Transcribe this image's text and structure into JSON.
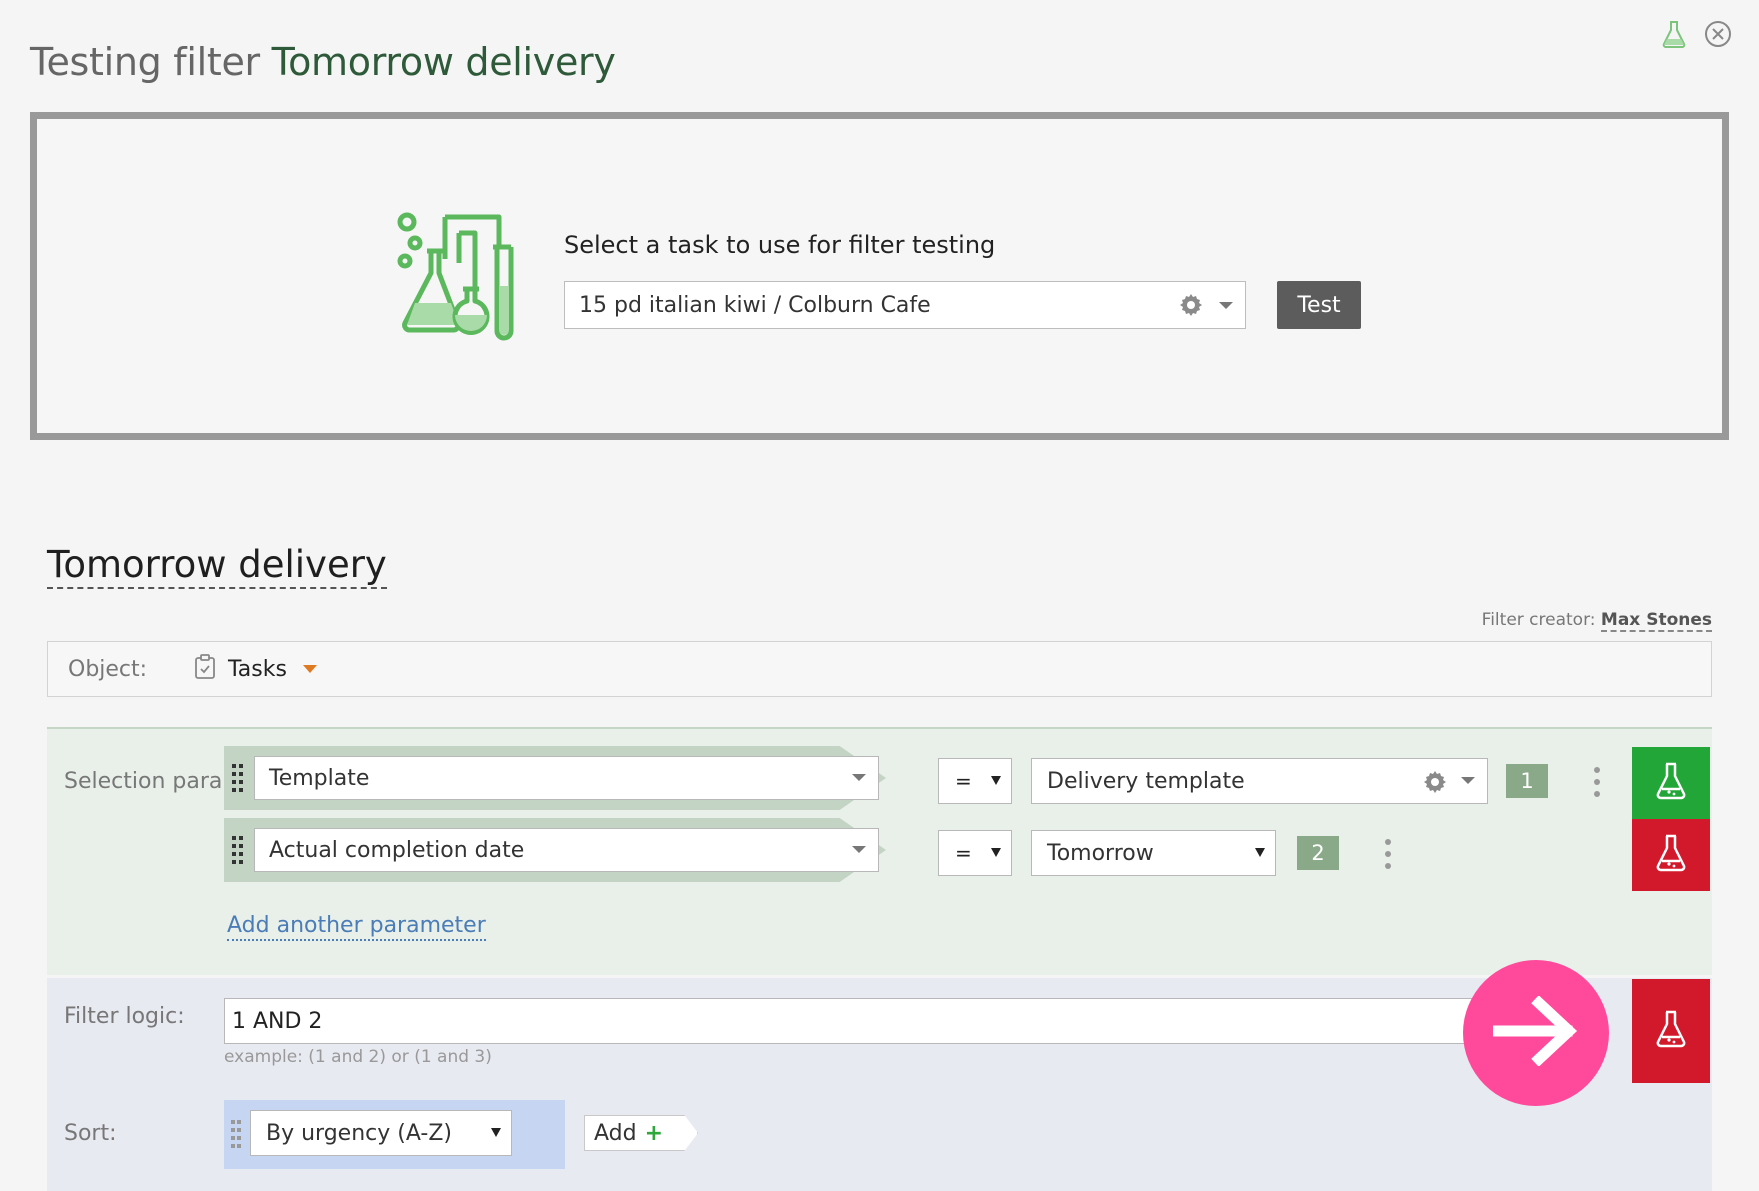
{
  "header": {
    "title_prefix": "Testing filter",
    "title_name": "Tomorrow delivery"
  },
  "top_icons": [
    "flask-icon",
    "close-icon"
  ],
  "test_panel": {
    "prompt": "Select a task to use for filter testing",
    "task_value": "15 pd italian kiwi / Colburn Cafe",
    "test_button": "Test"
  },
  "filter": {
    "name": "Tomorrow delivery",
    "creator_label": "Filter creator:",
    "creator_name": "Max Stones"
  },
  "object": {
    "label": "Object:",
    "value": "Tasks"
  },
  "selection": {
    "label": "Selection parameters:",
    "params": [
      {
        "field": "Template",
        "operator": "=",
        "value": "Delivery template",
        "index": "1"
      },
      {
        "field": "Actual completion date",
        "operator": "=",
        "value": "Tomorrow",
        "index": "2"
      }
    ],
    "add_link": "Add another parameter"
  },
  "logic": {
    "label": "Filter logic:",
    "value": "1 AND 2",
    "hint": "example: (1 and 2) or (1 and 3)"
  },
  "sort": {
    "label": "Sort:",
    "value": "By urgency (A-Z)",
    "add_label": "Add"
  },
  "colors": {
    "accent_green": "#21a637",
    "accent_red": "#d2182b",
    "fab_pink": "#ff4a9b",
    "title_green": "#2e5a3a"
  }
}
